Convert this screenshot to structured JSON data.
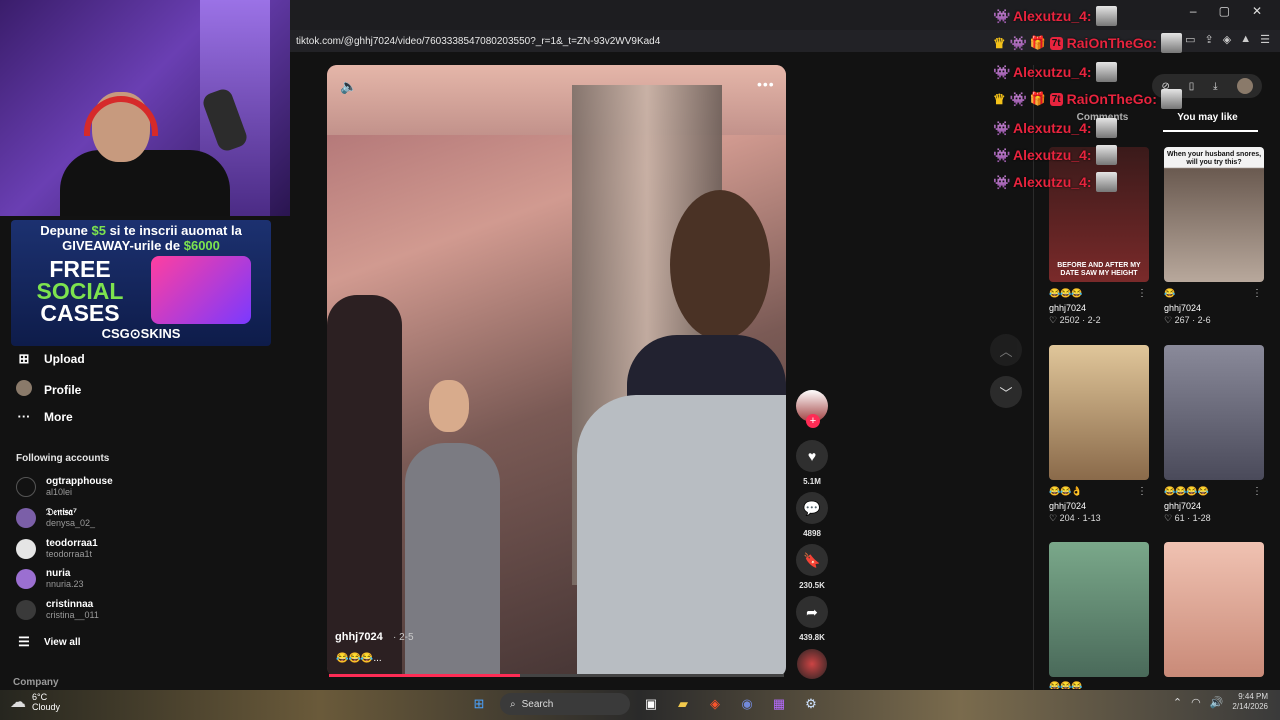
{
  "browser": {
    "url": "tiktok.com/@ghhj7024/video/7603338547080203550?_r=1&_t=ZN-93v2WV9Kad4",
    "window_controls": [
      "–",
      "▢",
      "✕"
    ],
    "url_icons": [
      "⊘",
      "▭",
      "⇪",
      "◈",
      "▲",
      "☰"
    ]
  },
  "chat": {
    "messages": [
      {
        "user": "Alexutzu_4:",
        "badges": [
          "bot"
        ]
      },
      {
        "user": "RaiOnTheGo:",
        "badges": [
          "crown",
          "bot",
          "gift",
          "7tv"
        ]
      },
      {
        "user": "Alexutzu_4:",
        "badges": [
          "bot"
        ]
      },
      {
        "user": "RaiOnTheGo:",
        "badges": [
          "crown",
          "bot",
          "gift",
          "7tv"
        ]
      },
      {
        "user": "Alexutzu_4:",
        "badges": [
          "bot"
        ]
      },
      {
        "user": "Alexutzu_4:",
        "badges": [
          "bot"
        ]
      },
      {
        "user": "Alexutzu_4:",
        "badges": [
          "bot"
        ]
      }
    ],
    "seven_label": "7t"
  },
  "ad": {
    "line1_prefix": "Depune",
    "line1_amount": "$5",
    "line1_suffix": "si te inscrii auomat la",
    "line2_prefix": "GIVEAWAY-urile de",
    "line2_amount": "$6000",
    "big_free": "FREE",
    "big_social": "SOCIAL",
    "big_cases": "CASES",
    "brand": "CSG⊙SKINS"
  },
  "sidebar": {
    "nav": [
      {
        "label": "Upload",
        "icon": "plus-square-icon"
      },
      {
        "label": "Profile",
        "icon": "avatar"
      },
      {
        "label": "More",
        "icon": "dots-icon"
      }
    ],
    "following_title": "Following accounts",
    "accounts": [
      {
        "name": "ogtrapphouse",
        "handle": "al10lei",
        "color": "#121212"
      },
      {
        "name": "𝔇𝔢𝔫𝔦𝔰𝔞⁷",
        "handle": "denysa_02_",
        "color": "#7b5fa8"
      },
      {
        "name": "teodorraa1",
        "handle": "teodorraa1t",
        "color": "#e5e5e5"
      },
      {
        "name": "nuria",
        "handle": "nnuria.23",
        "color": "#9b6fd1"
      },
      {
        "name": "cristinnaa",
        "handle": "cristina__011",
        "color": "#3a3a3a"
      }
    ],
    "view_all": "View all",
    "company": "Company"
  },
  "video": {
    "author": "ghhj7024",
    "age": "· 2-5",
    "caption": "😂😂😂...",
    "progress": 0.42,
    "likes": "5.1M",
    "comments": "4898",
    "saves": "230.5K",
    "shares": "439.8K"
  },
  "right_panel": {
    "tabs": [
      "Comments",
      "You may like"
    ],
    "active_tab": "You may like",
    "cards": [
      {
        "emoji": "😂😂😂",
        "author": "ghhj7024",
        "stats": "♡ 2502 · 2-2",
        "caption": "BEFORE AND AFTER MY DATE SAW MY HEIGHT",
        "top": "",
        "bg": "#7a2a2a"
      },
      {
        "emoji": "😂",
        "author": "ghhj7024",
        "stats": "♡ 267 · 2-6",
        "caption": "",
        "top": "When your husband snores, will you try this?",
        "bg": "#d9d9d9"
      },
      {
        "emoji": "😂😂👌",
        "author": "ghhj7024",
        "stats": "♡ 204 · 1-13",
        "caption": "",
        "top": "",
        "bg": "#c9a77a"
      },
      {
        "emoji": "😂😂😂😂",
        "author": "ghhj7024",
        "stats": "♡ 61 · 1-28",
        "caption": "",
        "top": "",
        "bg": "#6a6a7a"
      },
      {
        "emoji": "😂😂😂",
        "author": "",
        "stats": "",
        "caption": "",
        "top": "",
        "bg": "#5d8d7a"
      },
      {
        "emoji": "",
        "author": "",
        "stats": "",
        "caption": "",
        "top": "",
        "bg": "#e7b6a8"
      }
    ]
  },
  "taskbar": {
    "temp": "6°C",
    "weather": "Cloudy",
    "search": "Search",
    "time": "9:44 PM",
    "date": "2/14/2026"
  }
}
